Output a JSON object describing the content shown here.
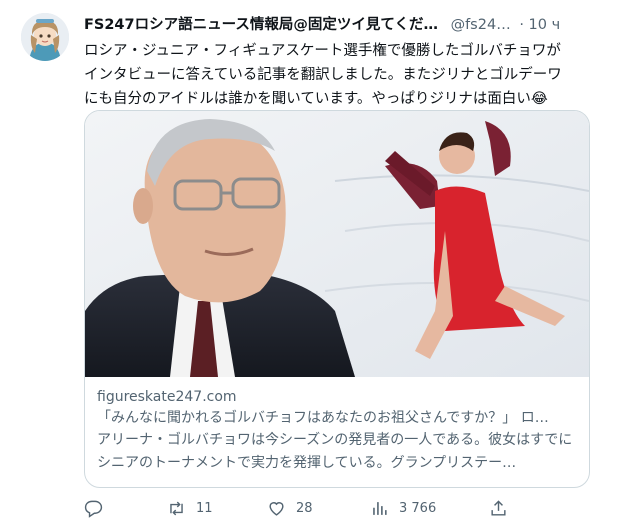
{
  "tweet": {
    "author_name": "FS247ロシア語ニュース情報局@固定ツイ見てくだ…",
    "handle": "@fs24…",
    "time": "· 10 ч",
    "text_lines": [
      "ロシア・ジュニア・フィギュアスケート選手権で優勝したゴルバチョワが",
      "インタビューに答えている記事を翻訳しました。またジリナとゴルデーワ",
      "にも自分のアイドルは誰かを聞いています。やっぱりジリナは面白い😂"
    ]
  },
  "card": {
    "domain": "figureskate247.com",
    "title": "「みんなに聞かれるゴルバチョフはあなたのお祖父さんですか？」 ロ…",
    "description": "アリーナ・ゴルバチョワは今シーズンの発見者の一人である。彼女はすでにシニアのトーナメントで実力を発揮している。グランプリステー…"
  },
  "actions": {
    "reply_count": "",
    "retweet_count": "11",
    "like_count": "28",
    "views_count": "3 766"
  },
  "icons": [
    "reply-icon",
    "retweet-icon",
    "like-icon",
    "views-icon",
    "share-icon"
  ],
  "colors": {
    "text": "#0f1419",
    "secondary": "#536471",
    "border": "#cfd9de"
  }
}
